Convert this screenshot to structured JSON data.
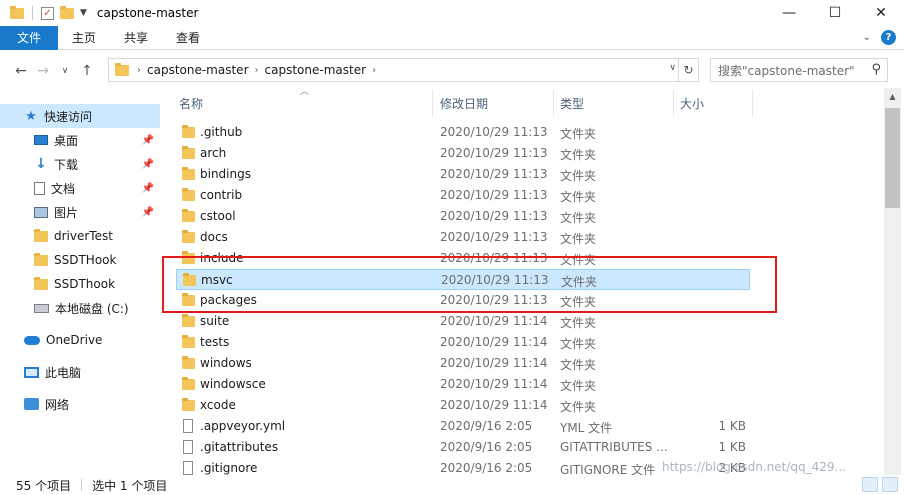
{
  "window": {
    "title": "capstone-master",
    "controls": [
      "—",
      "☐",
      "✕"
    ]
  },
  "ribbon": {
    "file_tab": "文件",
    "tabs": [
      "主页",
      "共享",
      "查看"
    ]
  },
  "address": {
    "crumbs": [
      "capstone-master",
      "capstone-master"
    ],
    "search_placeholder": "搜索\"capstone-master\""
  },
  "sidebar": {
    "items": [
      {
        "label": "快速访问",
        "icon": "star-icon",
        "pinned": false,
        "active": true
      },
      {
        "label": "桌面",
        "icon": "desktop-icon",
        "pinned": true
      },
      {
        "label": "下载",
        "icon": "download-icon",
        "pinned": true
      },
      {
        "label": "文档",
        "icon": "document-icon",
        "pinned": true
      },
      {
        "label": "图片",
        "icon": "pictures-icon",
        "pinned": true
      },
      {
        "label": "driverTest",
        "icon": "folder-icon",
        "pinned": false
      },
      {
        "label": "SSDTHook",
        "icon": "folder-icon",
        "pinned": false
      },
      {
        "label": "SSDThook",
        "icon": "folder-icon",
        "pinned": false
      },
      {
        "label": "本地磁盘 (C:)",
        "icon": "drive-icon",
        "pinned": false
      },
      {
        "label": "OneDrive",
        "icon": "cloud-icon",
        "pinned": false
      },
      {
        "label": "此电脑",
        "icon": "computer-icon",
        "pinned": false
      },
      {
        "label": "网络",
        "icon": "network-icon",
        "pinned": false
      }
    ]
  },
  "columns": {
    "name": "名称",
    "date": "修改日期",
    "type": "类型",
    "size": "大小"
  },
  "files": [
    {
      "name": ".github",
      "date": "2020/10/29 11:13",
      "type": "文件夹",
      "size": "",
      "kind": "folder"
    },
    {
      "name": "arch",
      "date": "2020/10/29 11:13",
      "type": "文件夹",
      "size": "",
      "kind": "folder"
    },
    {
      "name": "bindings",
      "date": "2020/10/29 11:13",
      "type": "文件夹",
      "size": "",
      "kind": "folder"
    },
    {
      "name": "contrib",
      "date": "2020/10/29 11:13",
      "type": "文件夹",
      "size": "",
      "kind": "folder"
    },
    {
      "name": "cstool",
      "date": "2020/10/29 11:13",
      "type": "文件夹",
      "size": "",
      "kind": "folder"
    },
    {
      "name": "docs",
      "date": "2020/10/29 11:13",
      "type": "文件夹",
      "size": "",
      "kind": "folder"
    },
    {
      "name": "include",
      "date": "2020/10/29 11:13",
      "type": "文件夹",
      "size": "",
      "kind": "folder"
    },
    {
      "name": "msvc",
      "date": "2020/10/29 11:13",
      "type": "文件夹",
      "size": "",
      "kind": "folder",
      "selected": true
    },
    {
      "name": "packages",
      "date": "2020/10/29 11:13",
      "type": "文件夹",
      "size": "",
      "kind": "folder"
    },
    {
      "name": "suite",
      "date": "2020/10/29 11:14",
      "type": "文件夹",
      "size": "",
      "kind": "folder"
    },
    {
      "name": "tests",
      "date": "2020/10/29 11:14",
      "type": "文件夹",
      "size": "",
      "kind": "folder"
    },
    {
      "name": "windows",
      "date": "2020/10/29 11:14",
      "type": "文件夹",
      "size": "",
      "kind": "folder"
    },
    {
      "name": "windowsce",
      "date": "2020/10/29 11:14",
      "type": "文件夹",
      "size": "",
      "kind": "folder"
    },
    {
      "name": "xcode",
      "date": "2020/10/29 11:14",
      "type": "文件夹",
      "size": "",
      "kind": "folder"
    },
    {
      "name": ".appveyor.yml",
      "date": "2020/9/16 2:05",
      "type": "YML 文件",
      "size": "1 KB",
      "kind": "file"
    },
    {
      "name": ".gitattributes",
      "date": "2020/9/16 2:05",
      "type": "GITATTRIBUTES ...",
      "size": "1 KB",
      "kind": "file"
    },
    {
      "name": ".gitignore",
      "date": "2020/9/16 2:05",
      "type": "GITIGNORE 文件",
      "size": "2 KB",
      "kind": "file"
    }
  ],
  "status": {
    "count": "55 个项目",
    "selected": "选中 1 个项目"
  },
  "watermark": "https://blog.csdn.net/qq_429..."
}
